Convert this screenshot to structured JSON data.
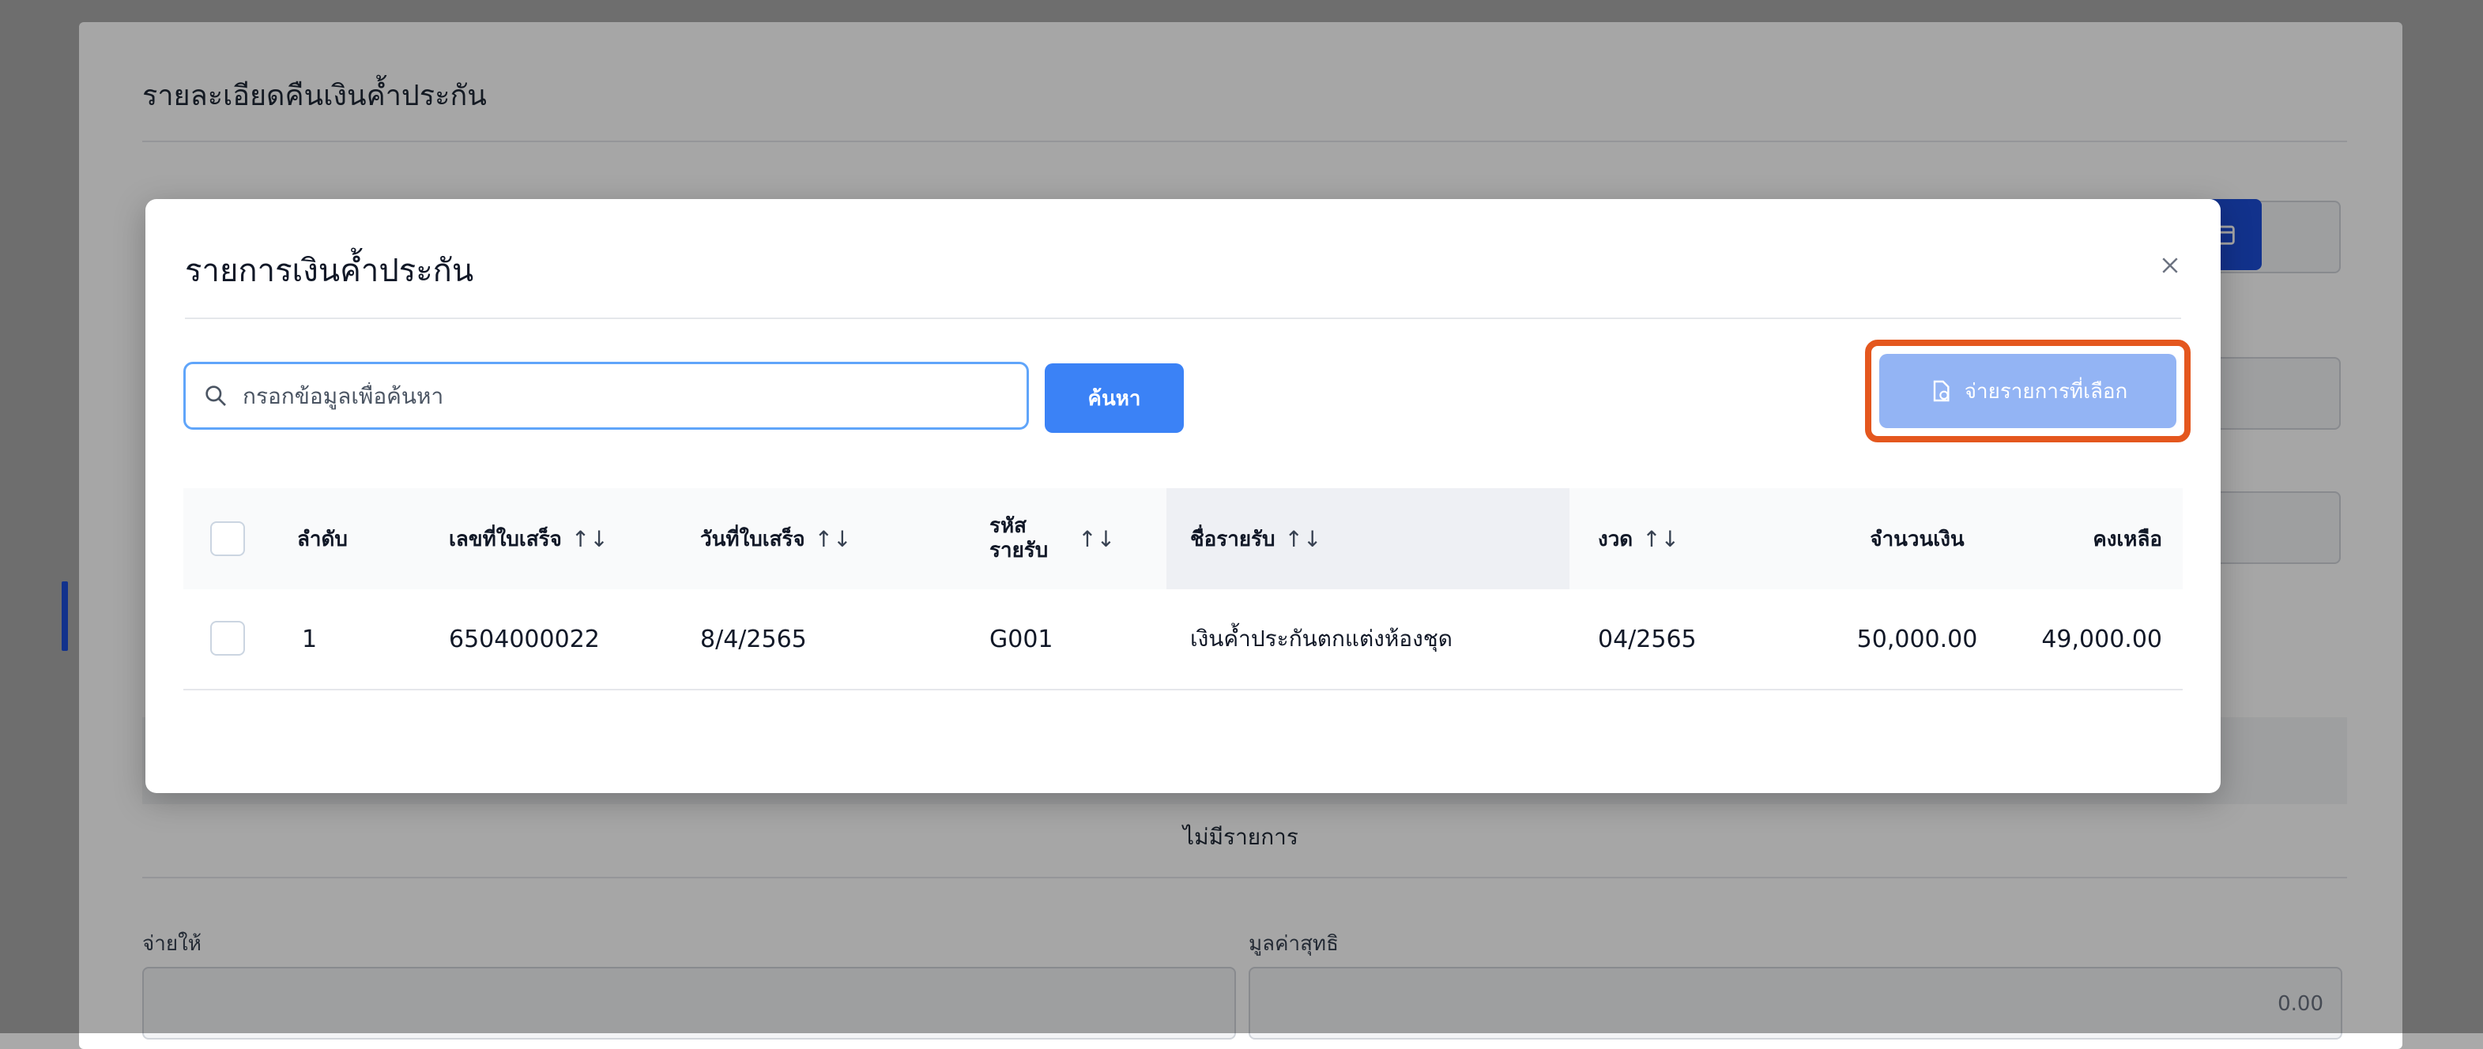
{
  "background": {
    "section_title": "รายละเอียดคืนเงินค้ำประกัน",
    "empty_text": "ไม่มีรายการ",
    "pay_to_label": "จ่ายให้",
    "net_value_label": "มูลค่าสุทธิ",
    "net_value": "0.00"
  },
  "modal": {
    "title": "รายการเงินค้ำประกัน",
    "search_placeholder": "กรอกข้อมูลเพื่อค้นหา",
    "search_button": "ค้นหา",
    "pay_selected_button": "จ่ายรายการที่เลือก",
    "highlight_color": "#e4571e",
    "primary_color": "#3b82f6",
    "table": {
      "headers": {
        "order": "ลำดับ",
        "receipt_no": "เลขที่ใบเสร็จ",
        "receipt_date": "วันที่ใบเสร็จ",
        "income_code_line1": "รหัส",
        "income_code_line2": "รายรับ",
        "income_name": "ชื่อรายรับ",
        "period": "งวด",
        "amount": "จำนวนเงิน",
        "balance": "คงเหลือ"
      },
      "sort_icon": "↑↓",
      "rows": [
        {
          "order": "1",
          "receipt_no": "6504000022",
          "receipt_date": "8/4/2565",
          "income_code": "G001",
          "income_name": "เงินค้ำประกันตกแต่งห้องชุด",
          "period": "04/2565",
          "amount": "50,000.00",
          "balance": "49,000.00"
        }
      ]
    }
  }
}
